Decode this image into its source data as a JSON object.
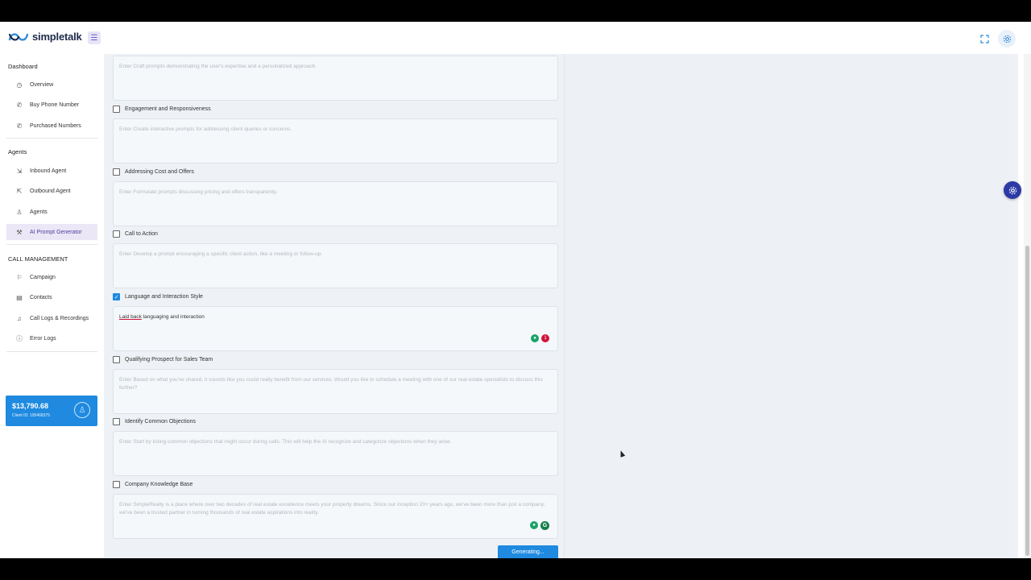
{
  "app": {
    "name": "simpletalk"
  },
  "sidebar": {
    "sections": [
      {
        "title": "Dashboard"
      },
      {
        "title": "Agents"
      },
      {
        "title": "CALL MANAGEMENT"
      }
    ],
    "items": [
      {
        "label": "Overview",
        "icon": "dashboard-icon"
      },
      {
        "label": "Buy Phone Number",
        "icon": "phone-icon"
      },
      {
        "label": "Purchased Numbers",
        "icon": "phone-icon"
      },
      {
        "label": "Inbound Agent",
        "icon": "inbound-icon"
      },
      {
        "label": "Outbound Agent",
        "icon": "outbound-icon"
      },
      {
        "label": "Agents",
        "icon": "user-icon"
      },
      {
        "label": "AI Prompt Generator",
        "icon": "magic-wand-icon",
        "active": true
      },
      {
        "label": "Campaign",
        "icon": "flag-icon"
      },
      {
        "label": "Contacts",
        "icon": "contacts-icon"
      },
      {
        "label": "Call Logs & Recordings",
        "icon": "microphone-icon"
      },
      {
        "label": "Error Logs",
        "icon": "alert-icon"
      }
    ],
    "balance": {
      "amount": "$13,790.68",
      "client_id": "Client ID: 195468375"
    }
  },
  "form": {
    "top_placeholder": "Enter Craft prompts demonstrating the user's expertise and a personalized approach.",
    "sections": [
      {
        "label": "Engagement and Responsiveness",
        "checked": false,
        "placeholder": "Enter Create interactive prompts for addressing client queries or concerns.",
        "value": ""
      },
      {
        "label": "Addressing Cost and Offers",
        "checked": false,
        "placeholder": "Enter Formulate prompts discussing pricing and offers transparently.",
        "value": ""
      },
      {
        "label": "Call to Action",
        "checked": false,
        "placeholder": "Enter Develop a prompt encouraging a specific client action, like a meeting or follow-up.",
        "value": ""
      },
      {
        "label": "Language and Interaction Style",
        "checked": true,
        "placeholder": "",
        "value_misspelled": "Laid back",
        "value": "languaging and interaction"
      },
      {
        "label": "Qualifying Prospect for Sales Team",
        "checked": false,
        "placeholder": "Enter Based on what you've shared, it sounds like you could really benefit from our services. Would you like to schedule a meeting with one of our real estate specialists to discuss this further?",
        "value": ""
      },
      {
        "label": "Identify Common Objections",
        "checked": false,
        "placeholder": "Enter Start by listing common objections that might occur during calls. This will help the AI recognize and categorize objections when they arise.",
        "value": ""
      },
      {
        "label": "Company Knowledge Base",
        "checked": false,
        "placeholder": "Enter SimpleRealty is a place where over two decades of real estate excellence meets your property dreams. Since our inception 20+ years ago, we've been more than just a company; we've been a trusted partner in turning thousands of real estate aspirations into reality.",
        "value": ""
      }
    ],
    "grammarly_badge_count": "1",
    "generate_label": "Generating..."
  },
  "colors": {
    "accent": "#1f8ae0",
    "active_nav": "#ebe7f7",
    "fab": "#2b3aa6"
  }
}
